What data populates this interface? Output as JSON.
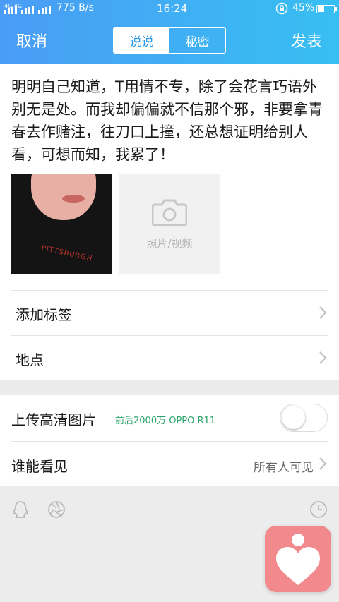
{
  "status_bar": {
    "network_speed": "775 B/s",
    "time": "16:24",
    "battery_percent": "45%",
    "battery_level": 0.45,
    "signal_text": "4G 4G"
  },
  "nav": {
    "cancel_label": "取消",
    "publish_label": "发表",
    "tabs": [
      {
        "label": "说说",
        "active": true
      },
      {
        "label": "秘密",
        "active": false
      }
    ]
  },
  "composer": {
    "text": "明明自己知道，T用情不专，除了会花言巧语外别无是处。而我却偏偏就不信那个邪，非要拿青春去作赌注，往刀口上撞，还总想证明给别人看，可想而知，我累了！",
    "photo_shirt_text": "PITTSBURGH",
    "add_media_label": "照片/视频",
    "add_tag_label": "添加标签",
    "location_label": "地点"
  },
  "settings": {
    "hd_upload_label": "上传高清图片",
    "hd_upload_sub": "前后2000万 OPPO R11",
    "hd_upload_enabled": false,
    "visibility_label": "谁能看见",
    "visibility_value": "所有人可见"
  },
  "toolbar": {
    "icons": [
      "qq-penguin-icon",
      "shutter-icon",
      "clock-icon"
    ]
  },
  "colors": {
    "header_gradient_start": "#4a9cf5",
    "header_gradient_end": "#37bff2",
    "hd_sub_text": "#2aa56a",
    "fab_background": "#f2898c"
  }
}
